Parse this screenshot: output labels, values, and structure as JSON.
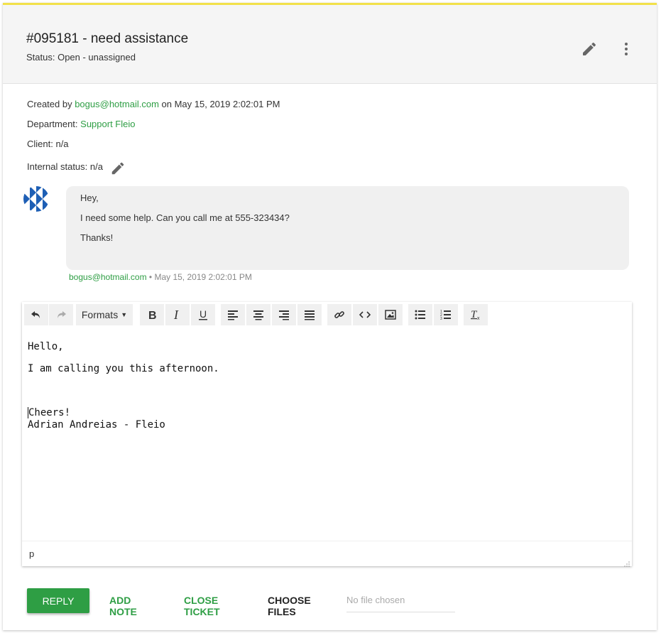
{
  "ticket": {
    "title": "#095181 - need assistance",
    "status": "Status: Open - unassigned"
  },
  "meta": {
    "created_prefix": "Created by ",
    "created_email": "bogus@hotmail.com",
    "created_suffix": " on May 15, 2019 2:02:01 PM",
    "department_label": "Department: ",
    "department_value": "Support Fleio",
    "client": "Client: n/a",
    "internal_status": "Internal status: n/a"
  },
  "message": {
    "lines": [
      "Hey,",
      "I need some help. Can you call me at 555-323434?",
      "Thanks!"
    ],
    "author": "bogus@hotmail.com",
    "timestamp": " • May 15, 2019 2:02:01 PM"
  },
  "editor": {
    "formats_label": "Formats",
    "content": [
      "Hello,",
      "I am calling you this afternoon.",
      "Cheers!",
      "Adrian Andreias - Fleio"
    ],
    "path": "p",
    "icons": [
      "undo-icon",
      "redo-icon",
      "bold-icon",
      "italic-icon",
      "underline-icon",
      "align-left-icon",
      "align-center-icon",
      "align-right-icon",
      "align-justify-icon",
      "link-icon",
      "code-icon",
      "image-icon",
      "bullet-list-icon",
      "numbered-list-icon",
      "clear-format-icon"
    ]
  },
  "actions": {
    "reply": "REPLY",
    "add_note": "ADD NOTE",
    "close_ticket": "CLOSE TICKET",
    "choose_files": "CHOOSE FILES",
    "no_file": "No file chosen"
  },
  "colors": {
    "accent": "#2e9e44",
    "top_border": "#f2e14a",
    "header_bg": "#f5f5f5"
  }
}
